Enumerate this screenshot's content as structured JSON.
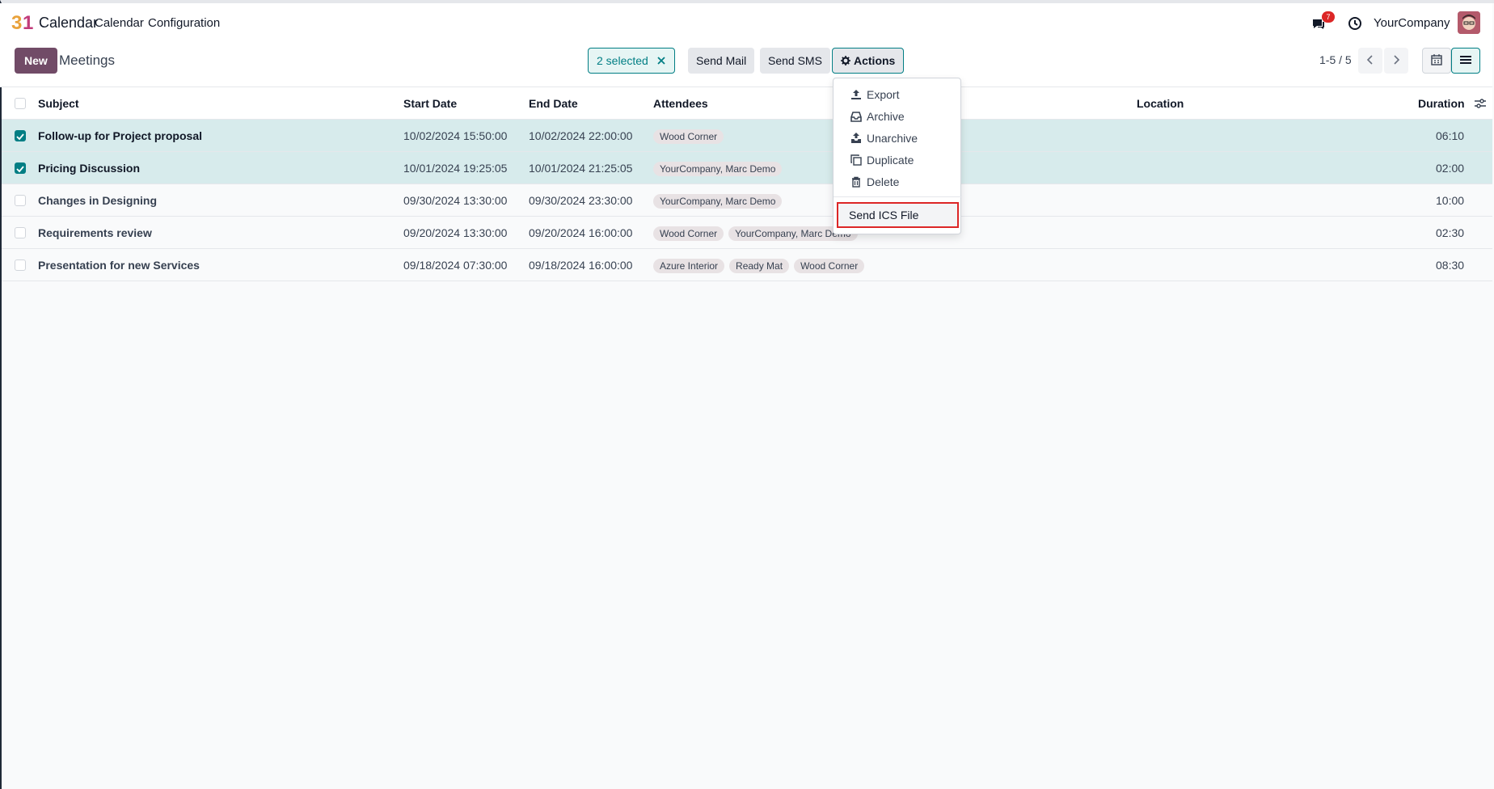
{
  "navbar": {
    "app_name": "Calendar",
    "menu": [
      "Calendar",
      "Configuration"
    ],
    "chat_count": "7",
    "company": "YourCompany"
  },
  "control": {
    "new_label": "New",
    "title": "Meetings",
    "selected_label": "2 selected",
    "send_mail": "Send Mail",
    "send_sms": "Send SMS",
    "actions": "Actions",
    "pager": "1-5 / 5"
  },
  "table": {
    "headers": [
      "Subject",
      "Start Date",
      "End Date",
      "Attendees",
      "Location",
      "Duration"
    ],
    "rows": [
      {
        "subject": "Follow-up for Project proposal",
        "start": "10/02/2024 15:50:00",
        "end": "10/02/2024 22:00:00",
        "attendees": [
          "Wood Corner"
        ],
        "location": "",
        "duration": "06:10",
        "checked": true
      },
      {
        "subject": "Pricing Discussion",
        "start": "10/01/2024 19:25:05",
        "end": "10/01/2024 21:25:05",
        "attendees": [
          "YourCompany, Marc Demo"
        ],
        "location": "",
        "duration": "02:00",
        "checked": true
      },
      {
        "subject": "Changes in Designing",
        "start": "09/30/2024 13:30:00",
        "end": "09/30/2024 23:30:00",
        "attendees": [
          "YourCompany, Marc Demo"
        ],
        "location": "",
        "duration": "10:00",
        "checked": false
      },
      {
        "subject": "Requirements review",
        "start": "09/20/2024 13:30:00",
        "end": "09/20/2024 16:00:00",
        "attendees": [
          "Wood Corner",
          "YourCompany, Marc Demo"
        ],
        "location": "",
        "duration": "02:30",
        "checked": false
      },
      {
        "subject": "Presentation for new Services",
        "start": "09/18/2024 07:30:00",
        "end": "09/18/2024 16:00:00",
        "attendees": [
          "Azure Interior",
          "Ready Mat",
          "Wood Corner"
        ],
        "location": "",
        "duration": "08:30",
        "checked": false
      }
    ]
  },
  "actions_menu": {
    "items": [
      "Export",
      "Archive",
      "Unarchive",
      "Duplicate",
      "Delete"
    ],
    "highlighted": "Send ICS File"
  }
}
